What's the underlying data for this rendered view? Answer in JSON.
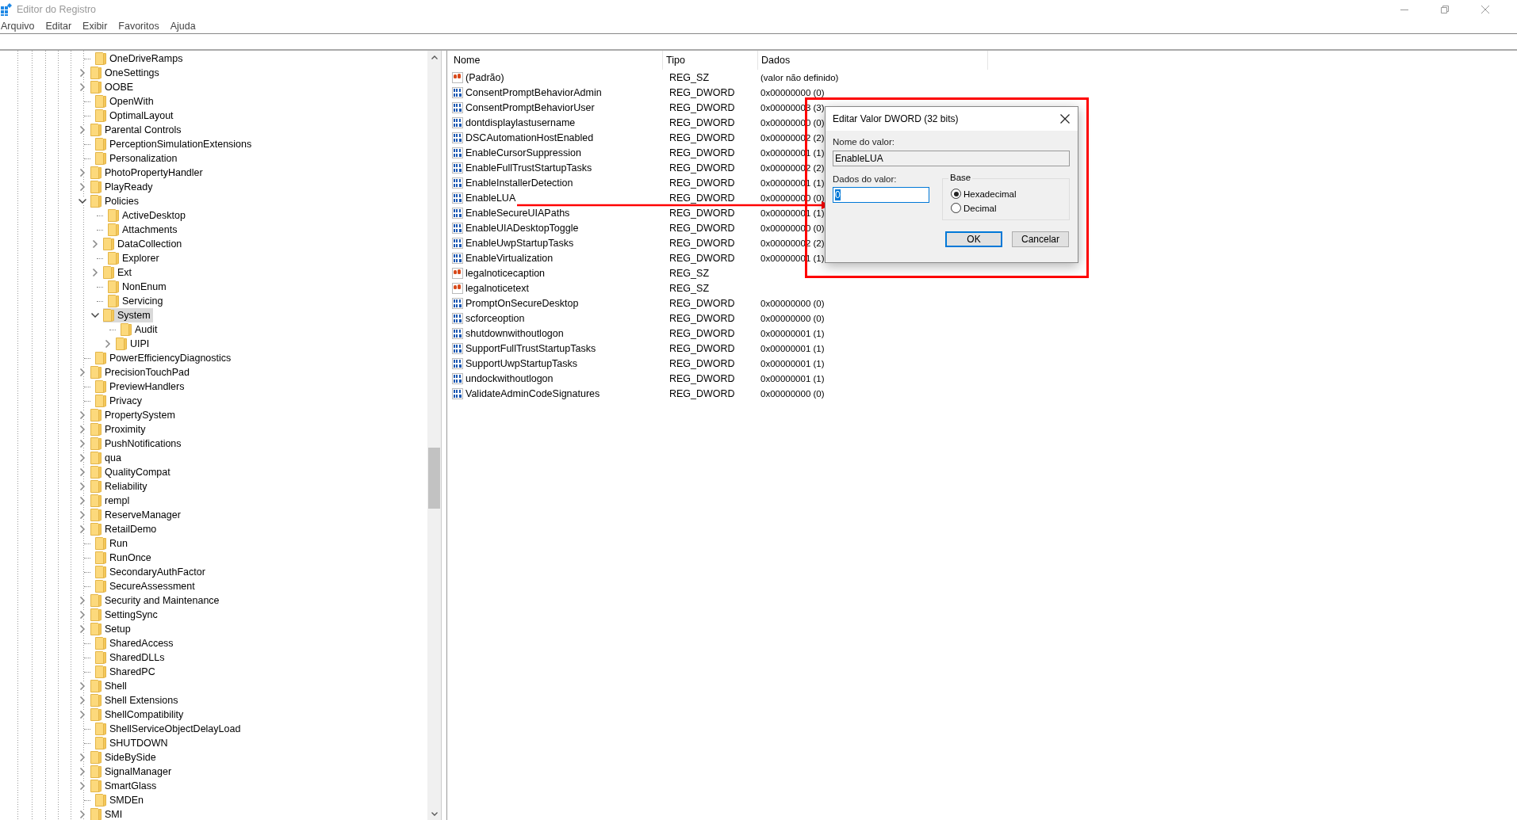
{
  "window": {
    "title": "Editor do Registro"
  },
  "menu": [
    "Arquivo",
    "Editar",
    "Exibir",
    "Favoritos",
    "Ajuda"
  ],
  "tree": [
    {
      "label": "OneDriveRamps",
      "expandable": false,
      "selected": false
    },
    {
      "label": "OneSettings",
      "expandable": true,
      "selected": false
    },
    {
      "label": "OOBE",
      "expandable": true,
      "selected": false
    },
    {
      "label": "OpenWith",
      "expandable": false,
      "selected": false
    },
    {
      "label": "OptimalLayout",
      "expandable": false,
      "selected": false
    },
    {
      "label": "Parental Controls",
      "expandable": true,
      "selected": false
    },
    {
      "label": "PerceptionSimulationExtensions",
      "expandable": false,
      "selected": false
    },
    {
      "label": "Personalization",
      "expandable": false,
      "selected": false
    },
    {
      "label": "PhotoPropertyHandler",
      "expandable": true,
      "selected": false
    },
    {
      "label": "PlayReady",
      "expandable": true,
      "selected": false
    },
    {
      "label": "Policies",
      "expandable": true,
      "expanded": true,
      "selected": false,
      "children": [
        {
          "label": "ActiveDesktop",
          "expandable": false,
          "selected": false
        },
        {
          "label": "Attachments",
          "expandable": false,
          "selected": false
        },
        {
          "label": "DataCollection",
          "expandable": true,
          "selected": false
        },
        {
          "label": "Explorer",
          "expandable": false,
          "selected": false
        },
        {
          "label": "Ext",
          "expandable": true,
          "selected": false
        },
        {
          "label": "NonEnum",
          "expandable": false,
          "selected": false
        },
        {
          "label": "Servicing",
          "expandable": false,
          "selected": false
        },
        {
          "label": "System",
          "expandable": true,
          "expanded": true,
          "selected": true,
          "children": [
            {
              "label": "Audit",
              "expandable": false,
              "selected": false
            },
            {
              "label": "UIPI",
              "expandable": true,
              "selected": false
            }
          ]
        }
      ]
    },
    {
      "label": "PowerEfficiencyDiagnostics",
      "expandable": false,
      "selected": false
    },
    {
      "label": "PrecisionTouchPad",
      "expandable": true,
      "selected": false
    },
    {
      "label": "PreviewHandlers",
      "expandable": false,
      "selected": false
    },
    {
      "label": "Privacy",
      "expandable": false,
      "selected": false
    },
    {
      "label": "PropertySystem",
      "expandable": true,
      "selected": false
    },
    {
      "label": "Proximity",
      "expandable": true,
      "selected": false
    },
    {
      "label": "PushNotifications",
      "expandable": true,
      "selected": false
    },
    {
      "label": "qua",
      "expandable": true,
      "selected": false
    },
    {
      "label": "QualityCompat",
      "expandable": true,
      "selected": false
    },
    {
      "label": "Reliability",
      "expandable": true,
      "selected": false
    },
    {
      "label": "rempl",
      "expandable": true,
      "selected": false
    },
    {
      "label": "ReserveManager",
      "expandable": true,
      "selected": false
    },
    {
      "label": "RetailDemo",
      "expandable": true,
      "selected": false
    },
    {
      "label": "Run",
      "expandable": false,
      "selected": false
    },
    {
      "label": "RunOnce",
      "expandable": false,
      "selected": false
    },
    {
      "label": "SecondaryAuthFactor",
      "expandable": false,
      "selected": false
    },
    {
      "label": "SecureAssessment",
      "expandable": false,
      "selected": false
    },
    {
      "label": "Security and Maintenance",
      "expandable": true,
      "selected": false
    },
    {
      "label": "SettingSync",
      "expandable": true,
      "selected": false
    },
    {
      "label": "Setup",
      "expandable": true,
      "selected": false
    },
    {
      "label": "SharedAccess",
      "expandable": false,
      "selected": false
    },
    {
      "label": "SharedDLLs",
      "expandable": false,
      "selected": false
    },
    {
      "label": "SharedPC",
      "expandable": false,
      "selected": false
    },
    {
      "label": "Shell",
      "expandable": true,
      "selected": false
    },
    {
      "label": "Shell Extensions",
      "expandable": true,
      "selected": false
    },
    {
      "label": "ShellCompatibility",
      "expandable": true,
      "selected": false
    },
    {
      "label": "ShellServiceObjectDelayLoad",
      "expandable": false,
      "selected": false
    },
    {
      "label": "SHUTDOWN",
      "expandable": false,
      "selected": false
    },
    {
      "label": "SideBySide",
      "expandable": true,
      "selected": false
    },
    {
      "label": "SignalManager",
      "expandable": true,
      "selected": false
    },
    {
      "label": "SmartGlass",
      "expandable": true,
      "selected": false
    },
    {
      "label": "SMDEn",
      "expandable": false,
      "selected": false
    },
    {
      "label": "SMI",
      "expandable": true,
      "selected": false
    }
  ],
  "table": {
    "columns": [
      "Nome",
      "Tipo",
      "Dados"
    ],
    "rows": [
      {
        "kind": "string",
        "name": "(Padrão)",
        "type": "REG_SZ",
        "data": "(valor não definido)"
      },
      {
        "kind": "binary",
        "name": "ConsentPromptBehaviorAdmin",
        "type": "REG_DWORD",
        "data": "0x00000000 (0)"
      },
      {
        "kind": "binary",
        "name": "ConsentPromptBehaviorUser",
        "type": "REG_DWORD",
        "data": "0x00000003 (3)"
      },
      {
        "kind": "binary",
        "name": "dontdisplaylastusername",
        "type": "REG_DWORD",
        "data": "0x00000000 (0)"
      },
      {
        "kind": "binary",
        "name": "DSCAutomationHostEnabled",
        "type": "REG_DWORD",
        "data": "0x00000002 (2)"
      },
      {
        "kind": "binary",
        "name": "EnableCursorSuppression",
        "type": "REG_DWORD",
        "data": "0x00000001 (1)"
      },
      {
        "kind": "binary",
        "name": "EnableFullTrustStartupTasks",
        "type": "REG_DWORD",
        "data": "0x00000002 (2)"
      },
      {
        "kind": "binary",
        "name": "EnableInstallerDetection",
        "type": "REG_DWORD",
        "data": "0x00000001 (1)"
      },
      {
        "kind": "binary",
        "name": "EnableLUA",
        "type": "REG_DWORD",
        "data": "0x00000000 (0)"
      },
      {
        "kind": "binary",
        "name": "EnableSecureUIAPaths",
        "type": "REG_DWORD",
        "data": "0x00000001 (1)"
      },
      {
        "kind": "binary",
        "name": "EnableUIADesktopToggle",
        "type": "REG_DWORD",
        "data": "0x00000000 (0)"
      },
      {
        "kind": "binary",
        "name": "EnableUwpStartupTasks",
        "type": "REG_DWORD",
        "data": "0x00000002 (2)"
      },
      {
        "kind": "binary",
        "name": "EnableVirtualization",
        "type": "REG_DWORD",
        "data": "0x00000001 (1)"
      },
      {
        "kind": "string",
        "name": "legalnoticecaption",
        "type": "REG_SZ"
      },
      {
        "kind": "string",
        "name": "legalnoticetext",
        "type": "REG_SZ"
      },
      {
        "kind": "binary",
        "name": "PromptOnSecureDesktop",
        "type": "REG_DWORD",
        "data": "0x00000000 (0)"
      },
      {
        "kind": "binary",
        "name": "scforceoption",
        "type": "REG_DWORD",
        "data": "0x00000000 (0)"
      },
      {
        "kind": "binary",
        "name": "shutdownwithoutlogon",
        "type": "REG_DWORD",
        "data": "0x00000001 (1)"
      },
      {
        "kind": "binary",
        "name": "SupportFullTrustStartupTasks",
        "type": "REG_DWORD",
        "data": "0x00000001 (1)"
      },
      {
        "kind": "binary",
        "name": "SupportUwpStartupTasks",
        "type": "REG_DWORD",
        "data": "0x00000001 (1)"
      },
      {
        "kind": "binary",
        "name": "undockwithoutlogon",
        "type": "REG_DWORD",
        "data": "0x00000001 (1)"
      },
      {
        "kind": "binary",
        "name": "ValidateAdminCodeSignatures",
        "type": "REG_DWORD",
        "data": "0x00000000 (0)"
      }
    ]
  },
  "dialog": {
    "title": "Editar Valor DWORD (32 bits)",
    "name_label": "Nome do valor:",
    "name_value": "EnableLUA",
    "data_label": "Dados do valor:",
    "data_value": "0",
    "base_label": "Base",
    "bases": [
      {
        "label": "Hexadecimal",
        "selected": true
      },
      {
        "label": "Decimal",
        "selected": false
      }
    ],
    "buttons": [
      "OK",
      "Cancelar"
    ]
  }
}
